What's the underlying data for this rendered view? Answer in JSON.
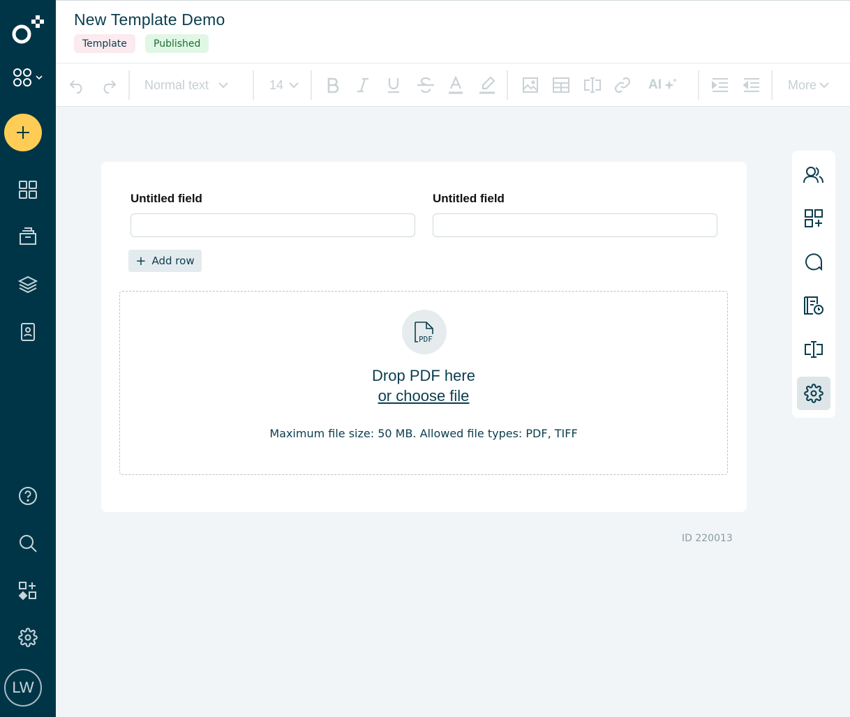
{
  "header": {
    "title": "New Template Demo",
    "badges": {
      "template": "Template",
      "published": "Published"
    }
  },
  "toolbar": {
    "text_style": "Normal text",
    "font_size": "14",
    "ai_label": "AI",
    "more_label": "More"
  },
  "form": {
    "field1_label": "Untitled field",
    "field2_label": "Untitled field",
    "add_row": "Add row",
    "add_row_icon": "+"
  },
  "dropzone": {
    "title": "Drop PDF here",
    "link": "or choose file",
    "hint": "Maximum file size: 50 MB. Allowed file types: PDF, TIFF",
    "icon_text": "PDF"
  },
  "doc_id": "ID 220013",
  "user": {
    "initials": "LW"
  },
  "colors": {
    "sidebar": "#003547",
    "accent_plus": "#ffcd56",
    "text": "#0a3d4e",
    "published_bg": "#e1f7e5",
    "template_bg": "#fbeaee"
  }
}
